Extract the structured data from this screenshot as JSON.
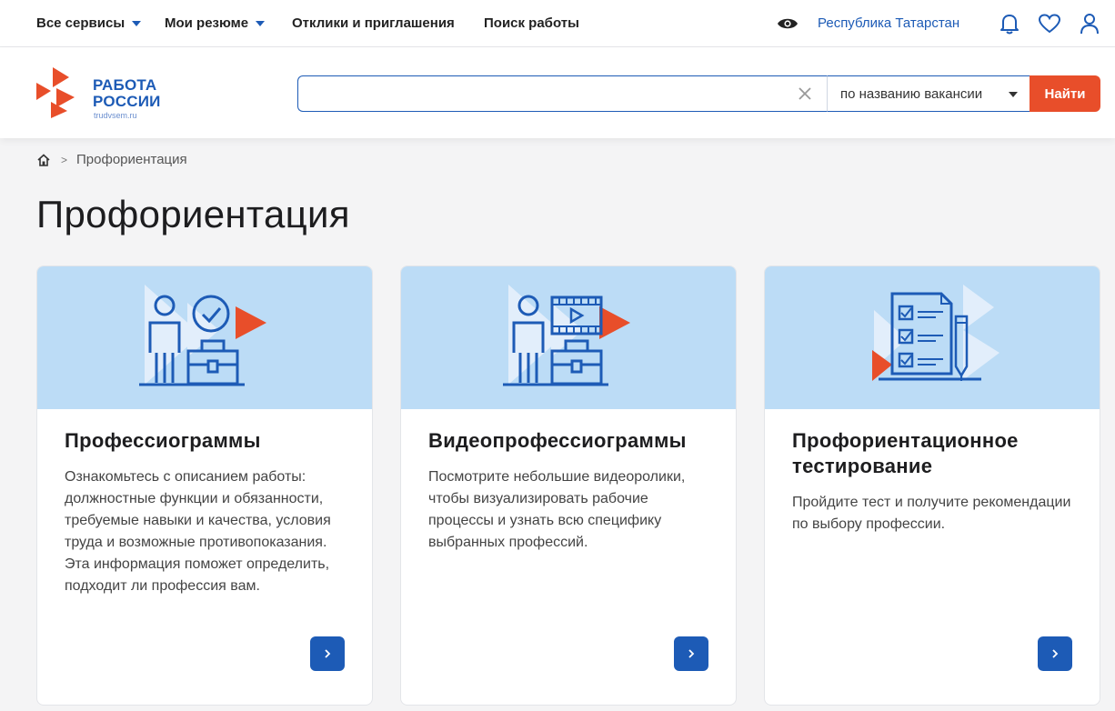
{
  "topnav": {
    "all_services": "Все сервисы",
    "my_resumes": "Мои резюме",
    "responses": "Отклики и приглашения",
    "job_search": "Поиск работы",
    "region": "Республика Татарстан",
    "icons": [
      "eye-icon",
      "bell-icon",
      "heart-icon",
      "user-icon"
    ]
  },
  "header": {
    "logo_line1": "РАБОТА",
    "logo_line2": "РОССИИ",
    "logo_site": "trudvsem.ru",
    "search_value": "",
    "search_mode": "по названию вакансии",
    "find_label": "Найти"
  },
  "breadcrumb": {
    "current": "Профориентация"
  },
  "page": {
    "title": "Профориентация"
  },
  "cards": [
    {
      "title": "Профессиограммы",
      "text": "Ознакомьтесь с описанием работы: должностные функции и обязанности, требуемые навыки и качества, условия труда и возможные противопоказания. Эта информация поможет определить, подходит ли профессия вам."
    },
    {
      "title": "Видеопрофессиограммы",
      "text": "Посмотрите небольшие видеоролики, чтобы визуализировать рабочие процессы и узнать всю специфику выбранных профессий."
    },
    {
      "title": "Профориентационное тестирование",
      "text": "Пройдите тест и получите рекомендации по выбору профессии."
    }
  ],
  "colors": {
    "brand_blue": "#1d5bb6",
    "accent_orange": "#e84e2a",
    "banner_blue": "#bcdcf6"
  }
}
